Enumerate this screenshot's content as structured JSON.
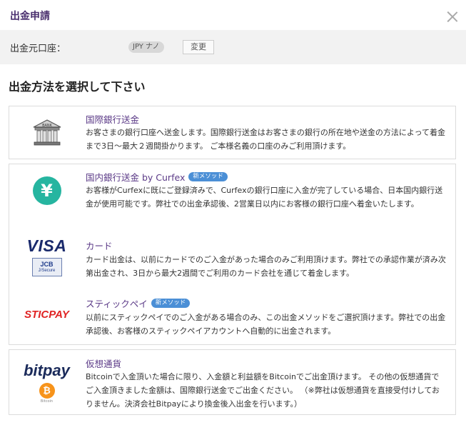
{
  "dialog": {
    "title": "出金申請"
  },
  "account": {
    "label": "出金元口座：",
    "currency_pill": "JPY ナノ",
    "change_label": "変更"
  },
  "heading": "出金方法を選択して下さい",
  "methods": [
    {
      "title": "国際銀行送金",
      "badge": "",
      "description": "お客さまの銀行口座へ送金します。国際銀行送金はお客さまの銀行の所在地や送金の方法によって着金まで3日〜最大２週間掛かります。 ご本様名義の口座のみご利用頂けます。"
    },
    {
      "title": "国内銀行送金 by Curfex",
      "badge": "新メソッド",
      "description": "お客様がCurfexに既にご登録済みで、Curfexの銀行口座に入金が完了している場合、日本国内銀行送金が使用可能です。弊社での出金承認後、2営業日以内にお客様の銀行口座へ着金いたします。"
    },
    {
      "title": "カード",
      "badge": "",
      "description": "カード出金は、以前にカードでのご入金があった場合のみご利用頂けます。弊社での承認作業が済み次第出金され、3日から最大2週間でご利用のカード会社を通じて着金します。"
    },
    {
      "title": "スティックペイ",
      "badge": "新メソッド",
      "description": "以前にスティックペイでのご入金がある場合のみ、この出金メソッドをご選択頂けます。弊社での出金承認後、お客様のスティックペイアカウントへ自動的に出金されます。"
    },
    {
      "title": "仮想通貨",
      "badge": "",
      "description": "Bitcoinで入金頂いた場合に限り、入金額と利益額をBitcoinでご出金頂けます。 その他の仮想通貨でご入金頂きました金額は、国際銀行送金でご出金ください。 （※弊社は仮想通貨を直接受付けしておりません。決済会社Bitpayにより換金後入出金を行います。）"
    }
  ],
  "logos": {
    "bank_icon": "bank-building-icon",
    "bank_sign": "BANK",
    "yen_symbol": "¥",
    "visa": "VISA",
    "jcb": "JCB",
    "jcb_sub": "J/Secure",
    "sticpay": "STICPAY",
    "bitpay": "bitpay",
    "bitcoin_symbol": "₿",
    "bitcoin_label": "Bitcoin"
  },
  "colors": {
    "title": "#4a2f6e",
    "method_title": "#5b3a87",
    "badge": "#4b8fd6",
    "yen_circle": "#26b5a0",
    "sticpay": "#e02424",
    "bitcoin": "#f7931a"
  }
}
